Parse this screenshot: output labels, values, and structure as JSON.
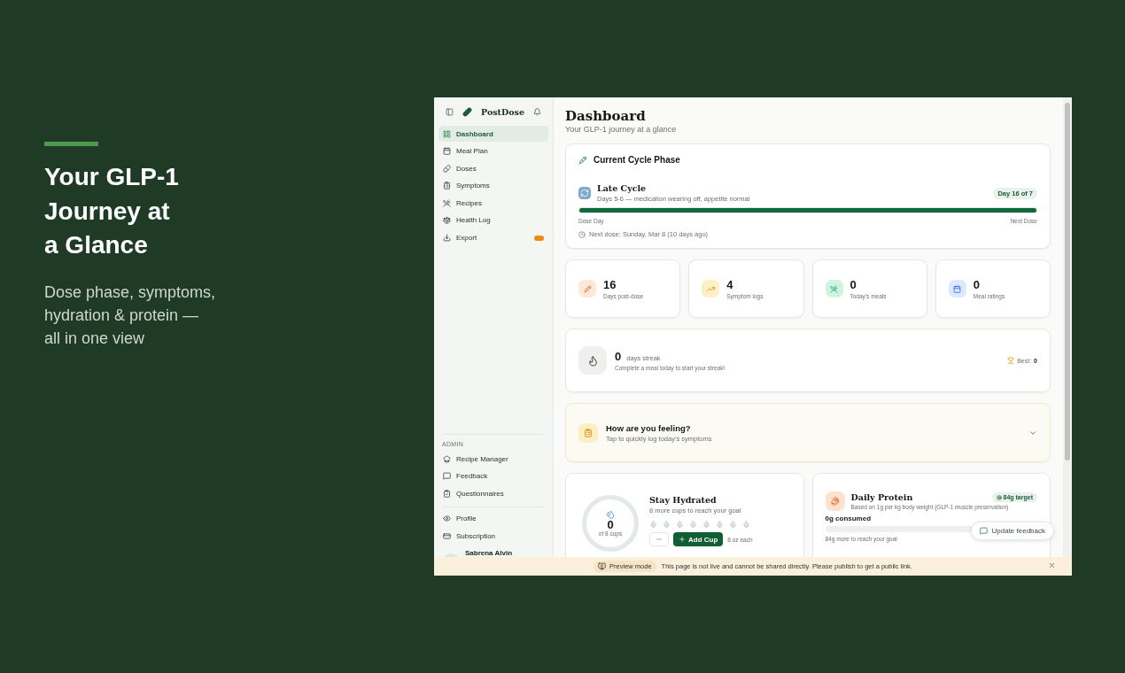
{
  "hero": {
    "title_lines": [
      "Your GLP-1",
      "Journey at",
      "a Glance"
    ],
    "subtitle_lines": [
      "Dose phase, symptoms,",
      "hydration & protein —",
      "all in one view"
    ]
  },
  "sidebar": {
    "brand": "PostDose",
    "items": [
      {
        "label": "Dashboard",
        "selected": true,
        "badge": false
      },
      {
        "label": "Meal Plan",
        "selected": false,
        "badge": false
      },
      {
        "label": "Doses",
        "selected": false,
        "badge": false
      },
      {
        "label": "Symptoms",
        "selected": false,
        "badge": false
      },
      {
        "label": "Recipes",
        "selected": false,
        "badge": false
      },
      {
        "label": "Health Log",
        "selected": false,
        "badge": false
      },
      {
        "label": "Export",
        "selected": false,
        "badge": true
      }
    ],
    "admin_label": "ADMIN",
    "admin_items": [
      {
        "label": "Recipe Manager"
      },
      {
        "label": "Feedback"
      },
      {
        "label": "Questionnaires"
      }
    ],
    "account_items": [
      {
        "label": "Profile"
      },
      {
        "label": "Subscription"
      }
    ],
    "user": {
      "name": "Sabrena Alvin"
    }
  },
  "page": {
    "title": "Dashboard",
    "subtitle": "Your GLP-1 journey at a glance"
  },
  "cycle": {
    "title": "Current Cycle Phase",
    "phase": "Late Cycle",
    "description": "Days 5-6 — medication wearing off, appetite normal",
    "day_badge": "Day 16 of 7",
    "level": 1,
    "start_label": "Dose Day",
    "end_label": "Next Dose",
    "next_dose": "Next dose: Sunday, Mar 8 (10 days ago)"
  },
  "stats": [
    {
      "value": "16",
      "label": "Days post-dose",
      "color": "#fde9d8"
    },
    {
      "value": "4",
      "label": "Symptom logs",
      "color": "#fdf0c4"
    },
    {
      "value": "0",
      "label": "Today's meals",
      "color": "#d3f3e1"
    },
    {
      "value": "0",
      "label": "Meal ratings",
      "color": "#dce8fd"
    }
  ],
  "streak": {
    "value": "0",
    "unit": "days streak",
    "hint": "Complete a meal today to start your streak!",
    "best_label": "Best:",
    "best_value": "0"
  },
  "feeling": {
    "title": "How are you feeling?",
    "subtitle": "Tap to quickly log today's symptoms",
    "expanded": false
  },
  "hydration": {
    "value": "0",
    "of": "of 8 cups",
    "level": 0,
    "title": "Stay Hydrated",
    "subtitle": "8 more cups to reach your goal",
    "cups": [
      {
        "filled": false
      },
      {
        "filled": false
      },
      {
        "filled": false
      },
      {
        "filled": false
      },
      {
        "filled": false
      },
      {
        "filled": false
      },
      {
        "filled": false
      },
      {
        "filled": false
      }
    ],
    "add_label": "Add Cup",
    "unit": "8 oz each"
  },
  "protein": {
    "title": "Daily Protein",
    "subtitle": "Based on 1g per kg body weight (GLP-1 muscle preservation)",
    "target": "84g target",
    "consumed": "0g consumed",
    "level": 0,
    "remaining": "84g more to reach your goal"
  },
  "feedback_button": "Update feedback",
  "preview_banner": {
    "badge": "Preview mode",
    "message": "This page is not live and cannot be shared directly. Please publish to get a public link."
  }
}
